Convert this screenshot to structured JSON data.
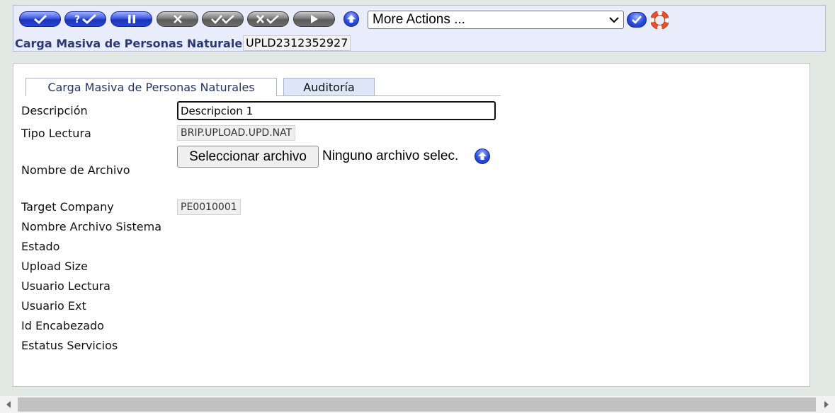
{
  "toolbar": {
    "more_actions": {
      "selected": "More Actions ..."
    }
  },
  "header": {
    "title": "Carga Masiva de Personas Naturales",
    "record_id": "UPLD2312352927"
  },
  "tabs": [
    {
      "label": "Carga Masiva de Personas Naturales"
    },
    {
      "label": "Auditoría"
    }
  ],
  "form": {
    "labels": {
      "descripcion": "Descripción",
      "tipo_lectura": "Tipo Lectura",
      "nombre_archivo": "Nombre de Archivo",
      "target_company": "Target Company",
      "nombre_archivo_sistema": "Nombre Archivo Sistema",
      "estado": "Estado",
      "upload_size": "Upload Size",
      "usuario_lectura": "Usuario Lectura",
      "usuario_ext": "Usuario Ext",
      "id_encabezado": "Id Encabezado",
      "estatus_servicios": "Estatus Servicios"
    },
    "values": {
      "descripcion": "Descripcion 1",
      "tipo_lectura": "BRIP.UPLOAD.UPD.NAT",
      "target_company": "PE0010001"
    },
    "file": {
      "button_label": "Seleccionar archivo",
      "status": "Ninguno archivo selec."
    }
  },
  "colors": {
    "accent_blue": "#2b4be0",
    "title_blue": "#2a3a78",
    "disabled_gray": "#6e6e6e"
  },
  "icons": [
    "commit-icon",
    "validate-icon",
    "hold-icon",
    "delete-icon",
    "authorise-icon",
    "reverse-icon",
    "next-icon",
    "upload-icon",
    "go-icon",
    "help-lifebuoy-icon"
  ]
}
